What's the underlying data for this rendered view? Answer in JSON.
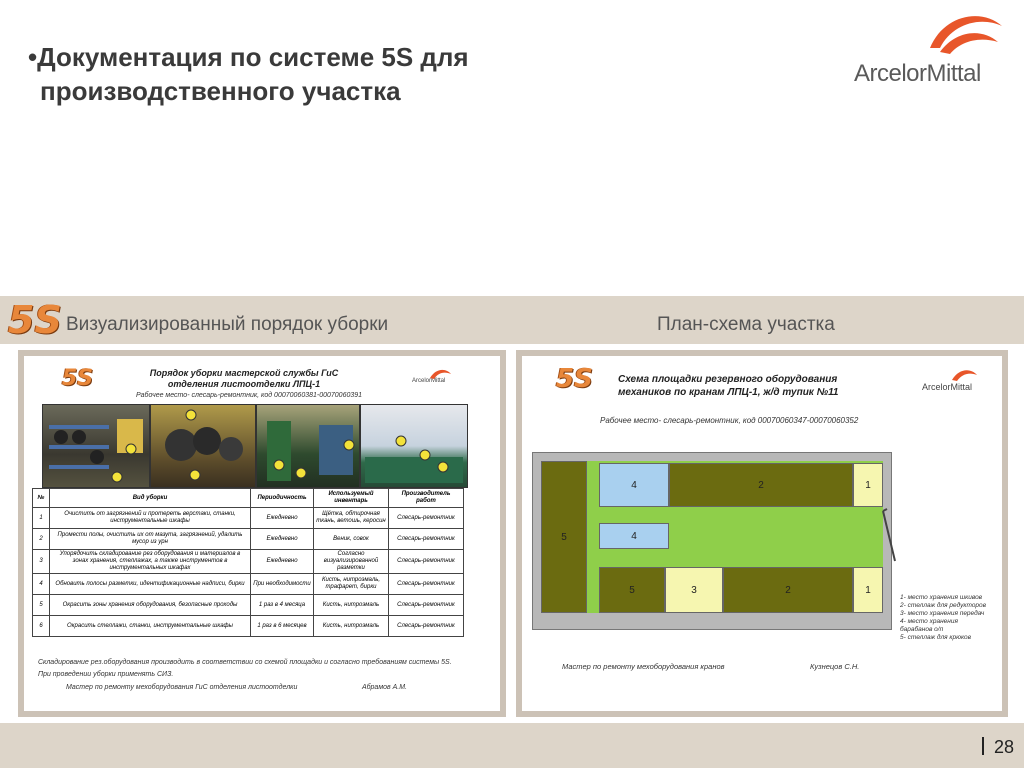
{
  "title": {
    "line1": "•Документация по системе 5S для",
    "line2": "производственного участка"
  },
  "logo": {
    "text": "ArcelorMittal"
  },
  "band": {
    "badge": "5S",
    "left_label": "Визуализированный порядок уборки",
    "right_label": "План-схема участка"
  },
  "page_number": "28",
  "colors": {
    "band": "#ddd5c9",
    "accent": "#e8873a",
    "olive": "#6b6b10",
    "green": "#8fcf4a",
    "blue": "#a9d0ef",
    "yellow": "#f6f6b0"
  },
  "left_doc": {
    "badge": "5S",
    "title1": "Порядок уборки мастерской службы ГиС",
    "title2": "отделения листоотделки ЛПЦ-1",
    "workplace": "Рабочее место- слесарь-ремонтник, код 00070060381-00070060391",
    "logo": "ArcelorMittal",
    "headers": [
      "№",
      "Вид уборки",
      "Периодичность",
      "Используемый инвентарь",
      "Производитель работ"
    ],
    "rows": [
      [
        "1",
        "Очистить от загрязнений и протереть верстаки, станки, инструментальные шкафы",
        "Ежедневно",
        "Щётка, обтирочная ткань, ветошь, керосин",
        "Слесарь-ремонтник"
      ],
      [
        "2",
        "Промести полы, очистить их от мазута, загрязнений, удалить мусор из урн",
        "Ежедневно",
        "Веник, совок",
        "Слесарь-ремонтник"
      ],
      [
        "3",
        "Упорядочить складирование рез оборудования и материалов в зонах хранения, стеллажах, а также инструментов в инструментальных шкафах",
        "Ежедневно",
        "Согласно визуализированной разметки",
        "Слесарь-ремонтник"
      ],
      [
        "4",
        "Обновить полосы разметки, идентификационные надписи, бирки",
        "При необходимости",
        "Кисть, нитроэмаль, трафарет, бирки",
        "Слесарь-ремонтник"
      ],
      [
        "5",
        "Окрасить зоны хранения оборудования, безопасные проходы",
        "1 раз в 4 месяца",
        "Кисть, нитроэмаль",
        "Слесарь-ремонтник"
      ],
      [
        "6",
        "Окрасить стеллажи, станки, инструментальные шкафы",
        "1 раз в 6 месяцев",
        "Кисть, нитроэмаль",
        "Слесарь-ремонтник"
      ]
    ],
    "note1": "Складирование рез.оборудования производить в соответствии со схемой площадки и согласно требованиям системы 5S.",
    "note2": "При проведении уборки применять СИЗ.",
    "signer_role": "Мастер по ремонту мехоборудования ГиС отделения листоотделки",
    "signer_name": "Абрамов А.М.",
    "photo_markers": [
      "3",
      "2",
      "3",
      "2",
      "5",
      "3",
      "6",
      "1",
      "2",
      "3"
    ]
  },
  "right_doc": {
    "badge": "5S",
    "title1": "Схема площадки резервного оборудования",
    "title2": "механиков по кранам ЛПЦ-1, ж/д тупик №11",
    "workplace": "Рабочее место- слесарь-ремонтник, код 00070060347-00070060352",
    "logo": "ArcelorMittal",
    "zones": [
      "5",
      "4",
      "2",
      "1",
      "4",
      "5",
      "3",
      "2",
      "1"
    ],
    "legend": [
      "1- место хранения шкивов",
      "2- стеллаж для редукторов",
      "3- место хранения передач",
      "4- место хранения",
      "барабанов о/п",
      "5- стеллаж для крюков"
    ],
    "signer_role": "Мастер по ремонту мехоборудования кранов",
    "signer_name": "Кузнецов С.Н."
  }
}
